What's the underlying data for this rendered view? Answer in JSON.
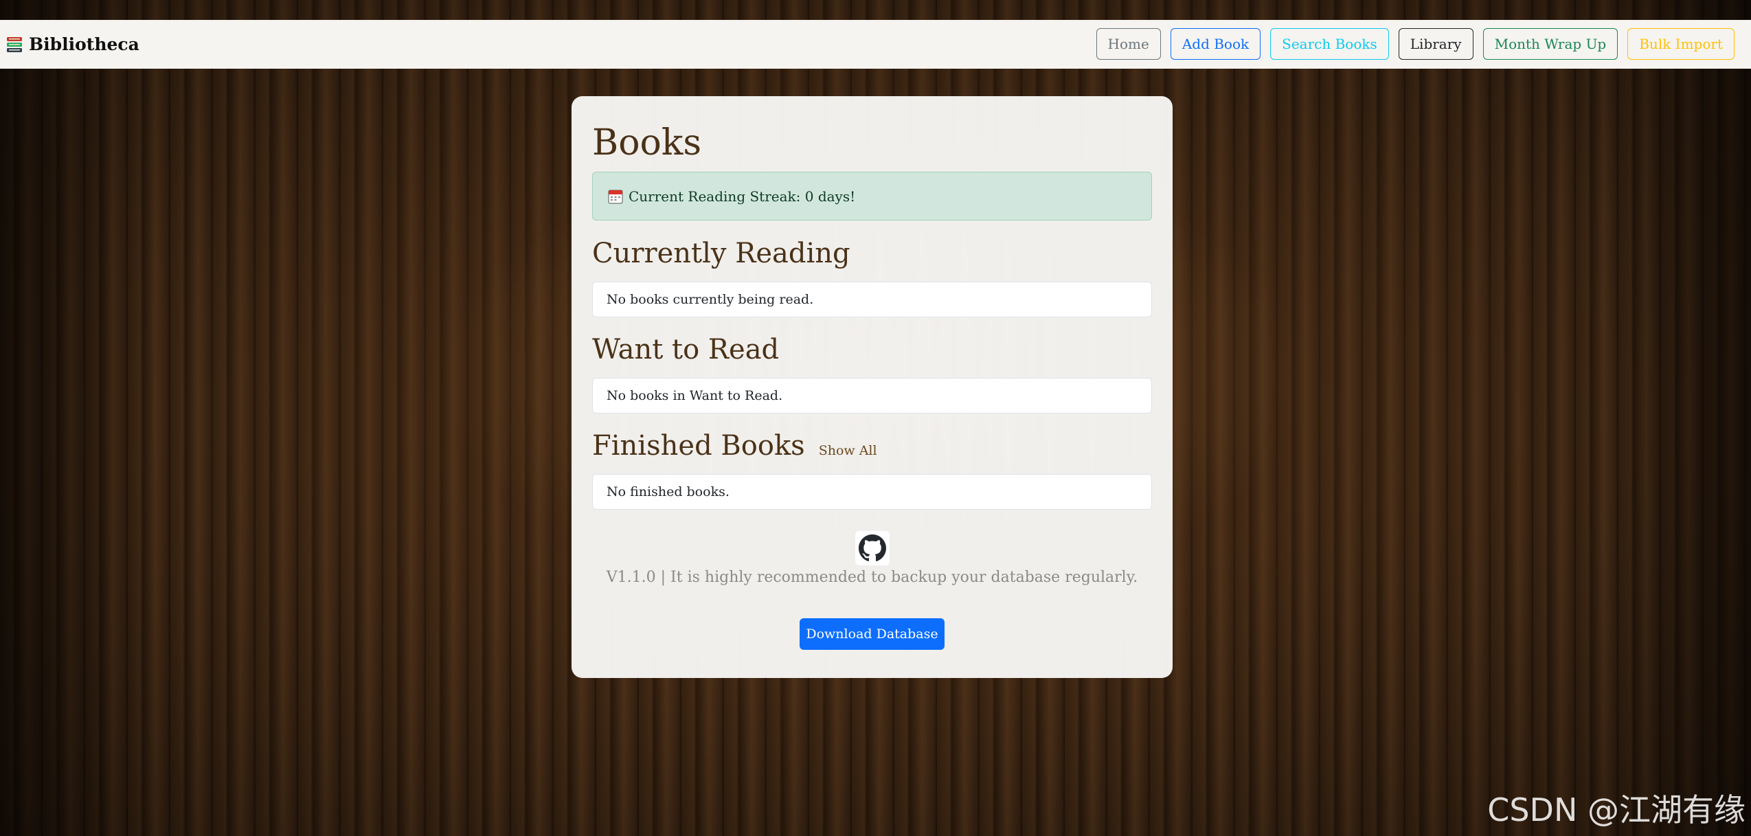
{
  "navbar": {
    "brand": "Bibliotheca",
    "buttons": {
      "home": "Home",
      "add_book": "Add Book",
      "search_books": "Search Books",
      "library": "Library",
      "month_wrap_up": "Month Wrap Up",
      "bulk_import": "Bulk Import"
    }
  },
  "main": {
    "title": "Books",
    "streak": "Current Reading Streak: 0 days!",
    "sections": {
      "currently_reading": {
        "title": "Currently Reading",
        "empty": "No books currently being read."
      },
      "want_to_read": {
        "title": "Want to Read",
        "empty": "No books in Want to Read."
      },
      "finished": {
        "title": "Finished Books",
        "show_all": "Show All",
        "empty": "No finished books."
      }
    },
    "footer": {
      "text": "V1.1.0 | It is highly recommended to backup your database regularly.",
      "download_label": "Download Database"
    }
  },
  "watermark": "CSDN @江湖有缘",
  "colors": {
    "primary": "#0d6efd",
    "success_bg": "#d1e7dd",
    "heading": "#4a3218"
  }
}
